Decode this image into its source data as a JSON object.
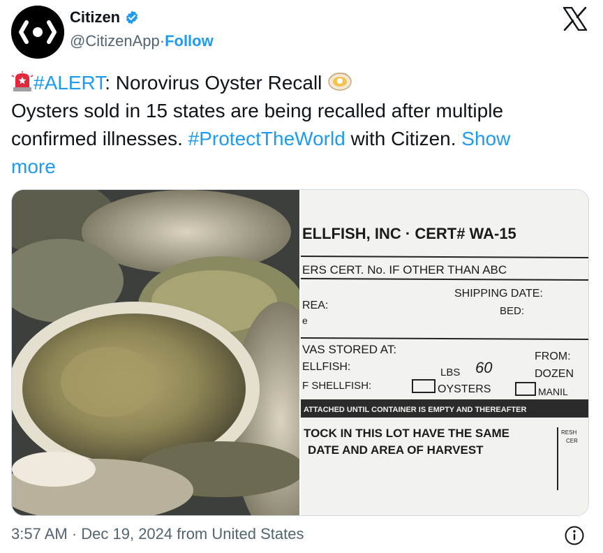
{
  "account": {
    "display_name": "Citizen",
    "handle": "@CitizenApp",
    "separator": " · ",
    "follow_label": "Follow",
    "verified_color": "#1d9bf0"
  },
  "icons": {
    "avatar": "citizen-logo",
    "verified": "verified-badge-icon",
    "x": "x-logo-icon",
    "alert": "police-light-emoji",
    "oyster": "oyster-emoji",
    "info": "info-icon"
  },
  "tweet": {
    "hashtag_alert": "#ALERT",
    "headline": ":  Norovirus Oyster Recall",
    "line2": "Oysters sold in 15 states are being recalled after multiple",
    "line3_before": "confirmed illnesses. ",
    "hashtag_protect": "#ProtectTheWorld",
    "line3_after": " with Citizen. ",
    "show_more_1": "Show",
    "show_more_2": "more"
  },
  "media": {
    "left": "oysters-photo",
    "right": {
      "header": "ELLFISH, INC  ·  CERT# WA-15",
      "row1": "ERS CERT. No. IF OTHER THAN ABC",
      "row2": "SHIPPING DATE:",
      "row3": "REA:",
      "row3b": "BED:",
      "row4": "e",
      "row5": "VAS STORED AT:",
      "row5b": "FROM:",
      "row6": "ELLFISH:",
      "row6b": "LBS",
      "row6c": "60",
      "row6d": "DOZEN",
      "row7": "F SHELLFISH:",
      "row7b": "OYSTERS",
      "row7c": "MANIL",
      "row8": "ATTACHED UNTIL CONTAINER IS EMPTY AND THEREAFTER",
      "row9": "TOCK IN THIS LOT HAVE THE SAME",
      "row10": "DATE AND AREA OF HARVEST",
      "row9b": "RESH",
      "row9c": "CER"
    }
  },
  "footer": {
    "timestamp": "3:57 AM · Dec 19, 2024 from United States"
  }
}
